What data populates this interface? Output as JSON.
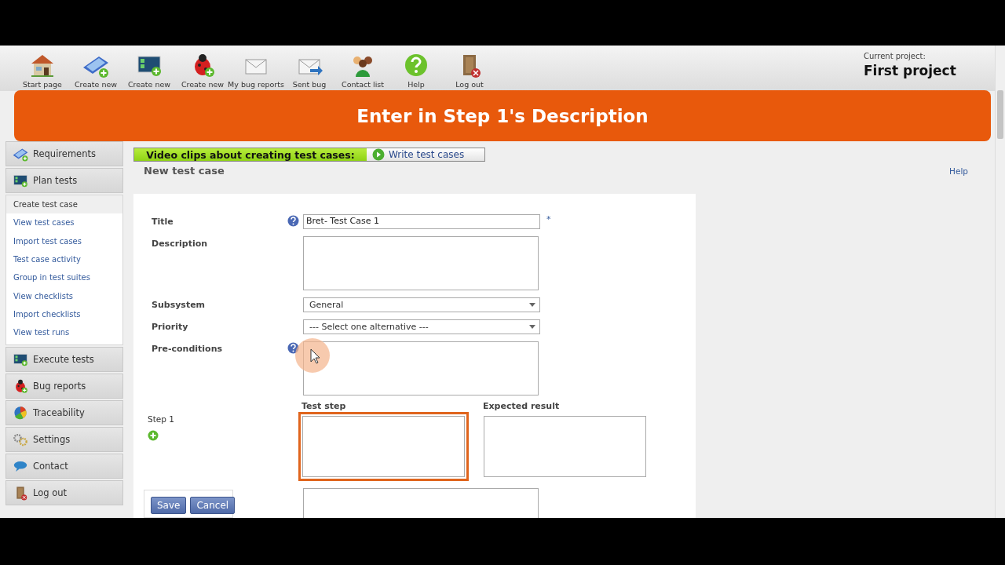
{
  "toolbar": {
    "items": [
      {
        "label": "Start page",
        "kind": "house"
      },
      {
        "label": "Create new",
        "kind": "device"
      },
      {
        "label": "Create new",
        "kind": "panel"
      },
      {
        "label": "Create new",
        "kind": "bug"
      },
      {
        "label": "My bug reports",
        "kind": "mail"
      },
      {
        "label": "Sent bug",
        "kind": "sent"
      },
      {
        "label": "Contact list",
        "kind": "people"
      },
      {
        "label": "Help",
        "kind": "help"
      },
      {
        "label": "Log out",
        "kind": "door"
      }
    ]
  },
  "current_project": {
    "caption": "Current project:",
    "name": "First project"
  },
  "banner": {
    "text": "Enter in Step 1's Description"
  },
  "sidebar": {
    "sections": [
      {
        "label": "Requirements",
        "kind": "device"
      },
      {
        "label": "Plan tests",
        "kind": "panel",
        "items": [
          {
            "label": "Create test case",
            "selected": true
          },
          {
            "label": "View test cases",
            "selected": false
          },
          {
            "label": "Import test cases",
            "selected": false
          },
          {
            "label": "Test case activity",
            "selected": false
          },
          {
            "label": "Group in test suites",
            "selected": false
          },
          {
            "label": "View checklists",
            "selected": false
          },
          {
            "label": "Import checklists",
            "selected": false
          },
          {
            "label": "View test runs",
            "selected": false
          }
        ]
      },
      {
        "label": "Execute tests",
        "kind": "panel"
      },
      {
        "label": "Bug reports",
        "kind": "bug"
      },
      {
        "label": "Traceability",
        "kind": "pie"
      },
      {
        "label": "Settings",
        "kind": "gears"
      },
      {
        "label": "Contact",
        "kind": "bubble"
      },
      {
        "label": "Log out",
        "kind": "door"
      }
    ]
  },
  "video_bar": {
    "caption": "Video clips about creating test cases:",
    "link": "Write test cases"
  },
  "page_title": "New test case",
  "help_link": "Help",
  "form": {
    "fields": [
      {
        "label": "Title",
        "kind": "input",
        "help": true,
        "value": "Bret- Test Case 1",
        "required": "*"
      },
      {
        "label": "Description",
        "kind": "textarea"
      },
      {
        "label": "Subsystem",
        "kind": "select",
        "value": "General"
      },
      {
        "label": "Priority",
        "kind": "select",
        "value": "--- Select one alternative ---"
      },
      {
        "label": "Pre-conditions",
        "kind": "textarea",
        "help": true
      }
    ],
    "step": {
      "label": "Step 1",
      "columns": [
        {
          "label": "Test step",
          "highlighted": true
        },
        {
          "label": "Expected result",
          "highlighted": false
        }
      ]
    }
  },
  "buttons": [
    "Save",
    "Cancel"
  ]
}
